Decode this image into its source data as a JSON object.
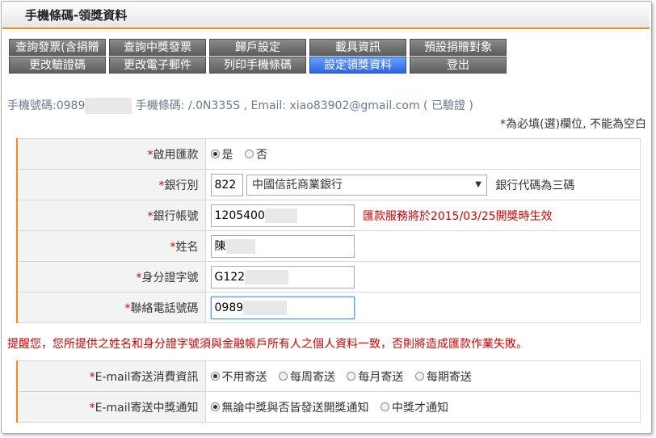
{
  "header": {
    "title": "手機條碼-領獎資料"
  },
  "nav": {
    "row1": [
      "查詢發票(含捐贈",
      "查詢中獎發票",
      "歸戶設定",
      "載具資訊",
      "預設捐贈對象"
    ],
    "row2": [
      "更改驗證碼",
      "更改電子郵件",
      "列印手機條碼",
      "設定領獎資料",
      "登出"
    ],
    "active_index": 3
  },
  "info": {
    "phone_label": "手機號碼:0989",
    "barcode_text": "手機條碼: /.0N335S , Email: xiao83902@gmail.com ( 已驗證 )"
  },
  "required_note": "*為必填(選)欄位, 不能為空白",
  "form1": {
    "remit": {
      "label": "啟用匯款",
      "options": [
        "是",
        "否"
      ],
      "selected": "是"
    },
    "bank": {
      "label": "銀行別",
      "code": "822",
      "name": "中國信託商業銀行",
      "hint": "銀行代碼為三碼"
    },
    "account": {
      "label": "銀行帳號",
      "value": "1205400",
      "notice": "匯款服務將於2015/03/25開獎時生效"
    },
    "name": {
      "label": "姓名",
      "value": "陳"
    },
    "id": {
      "label": "身分證字號",
      "value": "G122"
    },
    "tel": {
      "label": "聯絡電話號碼",
      "value": "0989"
    }
  },
  "warning": "提醒您，您所提供之姓名和身分證字號須與金融帳戶所有人之個人資料一致，否則將造成匯款作業失敗。",
  "form2": {
    "consume": {
      "label": "E-mail寄送消費資訊",
      "options": [
        "不用寄送",
        "每周寄送",
        "每月寄送",
        "每期寄送"
      ],
      "selected": "不用寄送"
    },
    "prize": {
      "label": "E-mail寄送中獎通知",
      "options": [
        "無論中獎與否皆發送開獎通知",
        "中獎才通知"
      ],
      "selected": "無論中獎與否皆發送開獎通知"
    }
  },
  "colors": {
    "accent": "#f58b1f",
    "required": "#d00000",
    "active_tab": "#2c64e4"
  }
}
